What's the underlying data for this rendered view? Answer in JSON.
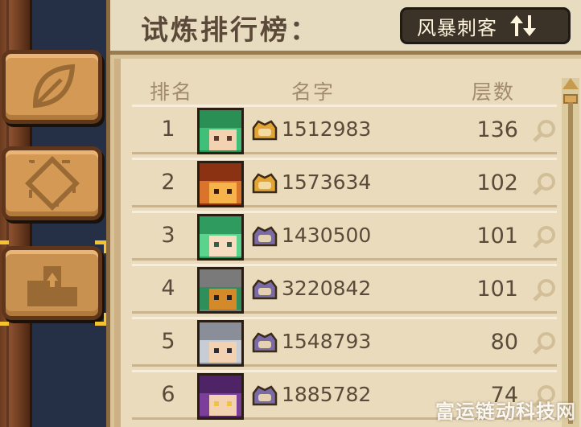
{
  "header": {
    "title": "试炼排行榜：",
    "mode_button": {
      "label": "风暴刺客",
      "icon": "swap-arrows-icon"
    }
  },
  "sidebar": {
    "items": [
      {
        "name": "leaf-tab",
        "icon": "leaf-icon",
        "active": false
      },
      {
        "name": "diamond-tab",
        "icon": "diamond-icon",
        "active": false
      },
      {
        "name": "leaderboard-tab",
        "icon": "podium-icon",
        "active": true
      }
    ]
  },
  "table": {
    "headers": {
      "rank": "排名",
      "name": "名字",
      "floors": "层数"
    },
    "rows": [
      {
        "rank": "1",
        "id": "1512983",
        "floors": "136",
        "badge": "gold",
        "avatar": "green-hair-hero"
      },
      {
        "rank": "2",
        "id": "1573634",
        "floors": "102",
        "badge": "gold",
        "avatar": "fire-hair-hero"
      },
      {
        "rank": "3",
        "id": "1430500",
        "floors": "101",
        "badge": "purple",
        "avatar": "green-hair-girl"
      },
      {
        "rank": "4",
        "id": "3220842",
        "floors": "101",
        "badge": "purple",
        "avatar": "masked-knight"
      },
      {
        "rank": "5",
        "id": "1548793",
        "floors": "80",
        "badge": "purple",
        "avatar": "silver-helmet"
      },
      {
        "rank": "6",
        "id": "1885782",
        "floors": "74",
        "badge": "purple",
        "avatar": "purple-hood"
      }
    ]
  },
  "colors": {
    "gold_badge": "#e2a535",
    "purple_badge": "#7a6aa6",
    "accent_corner": "#f4c430"
  },
  "watermark": "富运链动科技网"
}
